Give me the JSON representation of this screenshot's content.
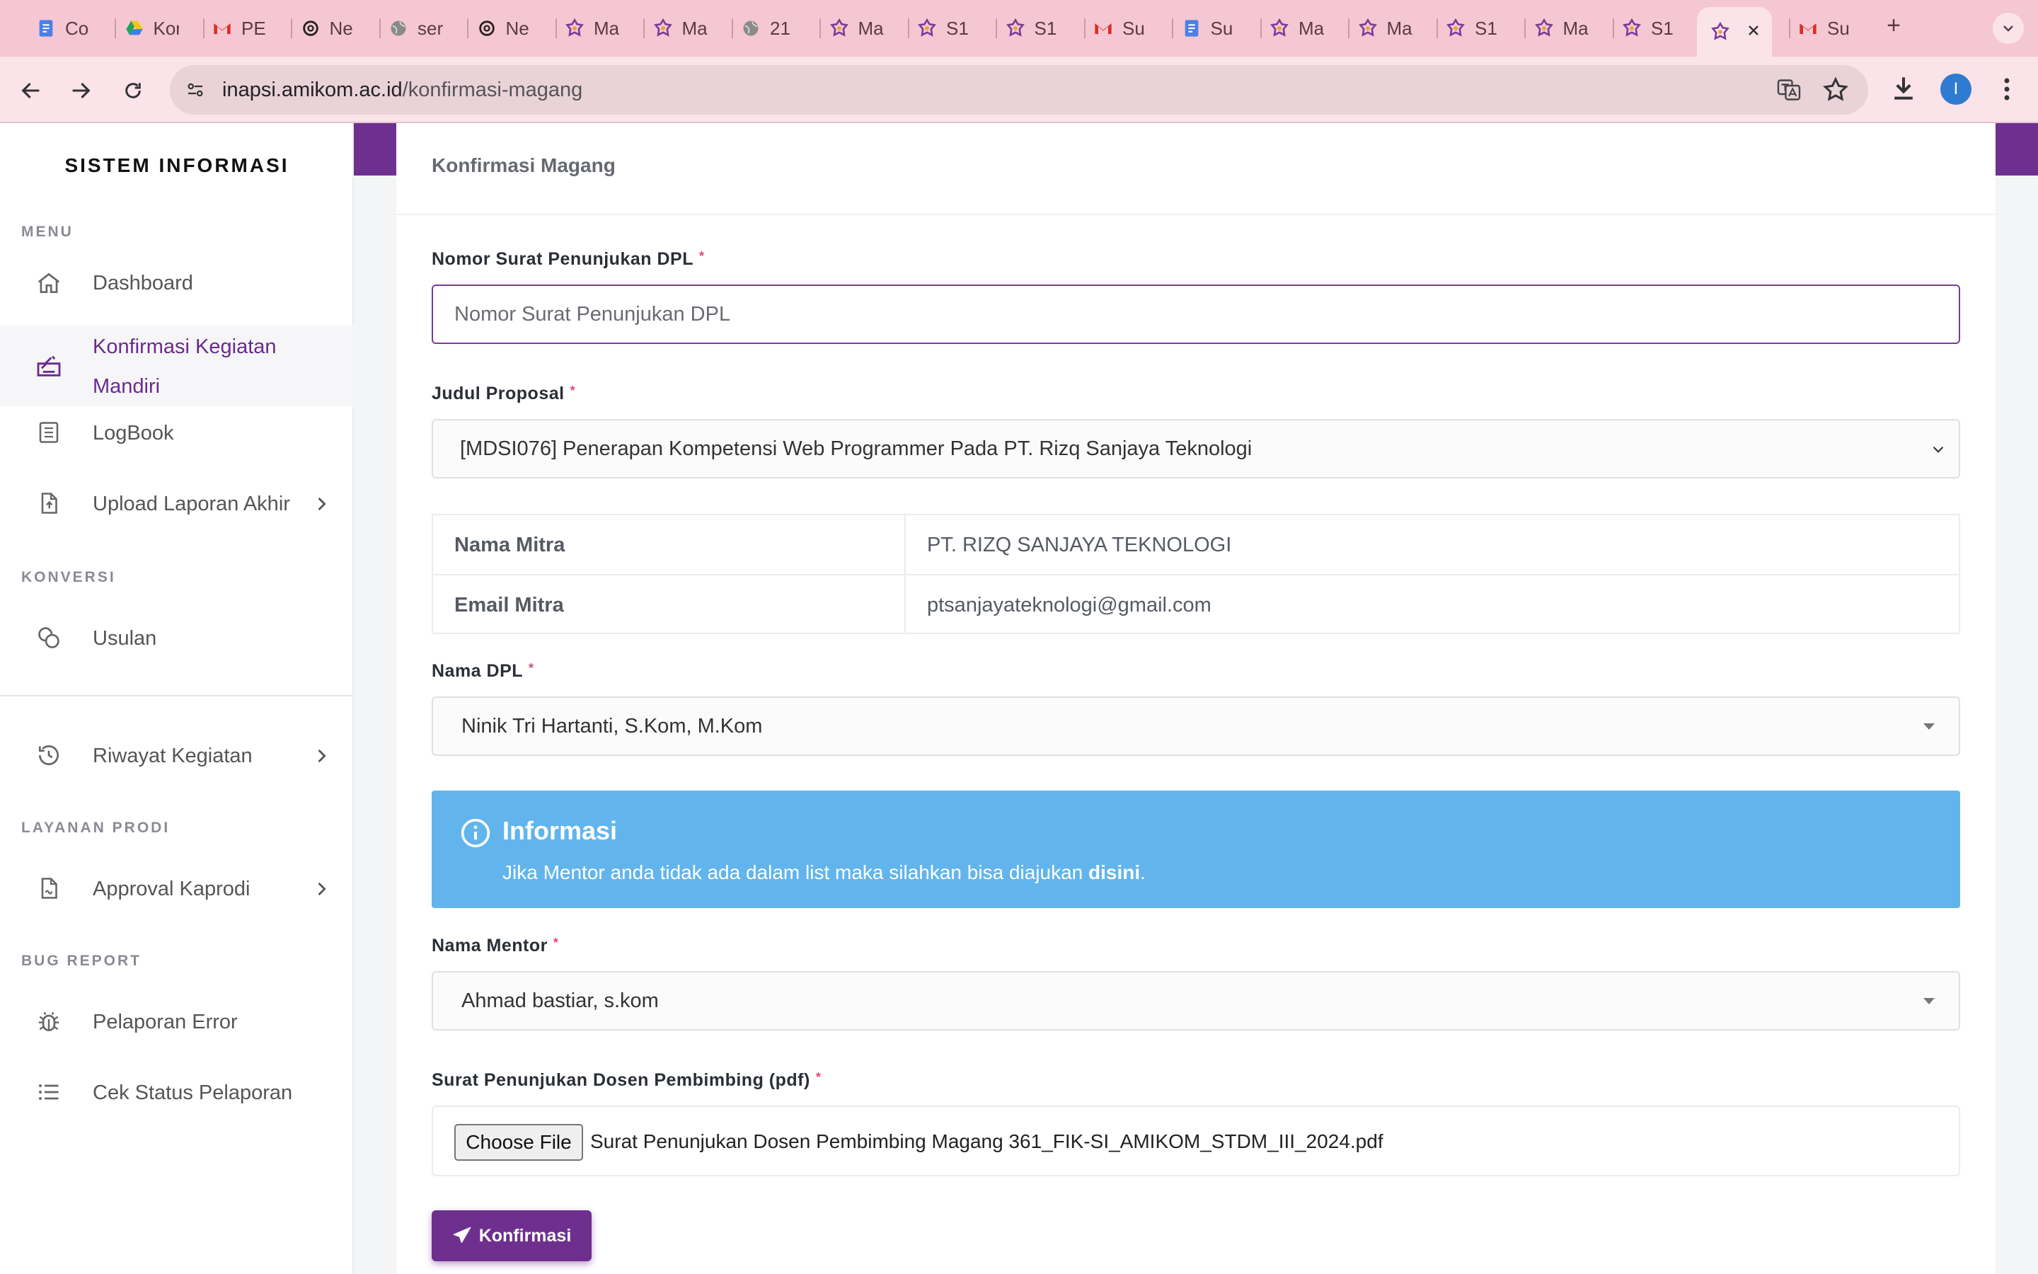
{
  "browser": {
    "tabs": [
      {
        "title": "Co",
        "icon": "google-docs-icon",
        "color": "#4a7fe5"
      },
      {
        "title": "Kor",
        "icon": "google-drive-icon",
        "color": "#1ea362"
      },
      {
        "title": "PE",
        "icon": "gmail-icon",
        "color": "#d93025"
      },
      {
        "title": "Ne",
        "icon": "chatgpt-icon",
        "color": "#222222"
      },
      {
        "title": "ser",
        "icon": "globe-icon",
        "color": "#8a8a8a"
      },
      {
        "title": "Ne",
        "icon": "chatgpt-icon",
        "color": "#222222"
      },
      {
        "title": "Ma",
        "icon": "amikom-icon",
        "color": "#7a3a9a"
      },
      {
        "title": "Ma",
        "icon": "amikom-icon",
        "color": "#7a3a9a"
      },
      {
        "title": "21",
        "icon": "globe-icon",
        "color": "#8a8a8a"
      },
      {
        "title": "Ma",
        "icon": "amikom-icon",
        "color": "#7a3a9a"
      },
      {
        "title": "S1",
        "icon": "amikom-icon",
        "color": "#7a3a9a"
      },
      {
        "title": "S1",
        "icon": "amikom-icon",
        "color": "#7a3a9a"
      },
      {
        "title": "Su",
        "icon": "gmail-icon",
        "color": "#d93025"
      },
      {
        "title": "Su",
        "icon": "google-docs-icon",
        "color": "#4a7fe5"
      },
      {
        "title": "Ma",
        "icon": "amikom-icon",
        "color": "#7a3a9a"
      },
      {
        "title": "Ma",
        "icon": "amikom-icon",
        "color": "#7a3a9a"
      },
      {
        "title": "S1",
        "icon": "amikom-icon",
        "color": "#7a3a9a"
      },
      {
        "title": "Ma",
        "icon": "amikom-icon",
        "color": "#7a3a9a"
      },
      {
        "title": "S1",
        "icon": "amikom-icon",
        "color": "#7a3a9a"
      },
      {
        "title": "",
        "icon": "amikom-icon",
        "color": "#7a3a9a",
        "active": true
      },
      {
        "title": "Su",
        "icon": "gmail-icon",
        "color": "#d93025"
      }
    ],
    "new_tab_label": "+",
    "url_host": "inapsi.amikom.ac.id",
    "url_path": "/konfirmasi-magang",
    "profile_initial": "I",
    "accent_color": "#f5c7d2"
  },
  "sidebar": {
    "brand": "SISTEM INFORMASI",
    "sections": {
      "menu": "MENU",
      "konversi": "KONVERSI",
      "layanan": "LAYANAN PRODI",
      "bug": "BUG REPORT"
    },
    "items": {
      "dashboard": "Dashboard",
      "konfirmasi_line1": "Konfirmasi Kegiatan",
      "konfirmasi_line2": "Mandiri",
      "logbook": "LogBook",
      "upload": "Upload Laporan Akhir",
      "usulan": "Usulan",
      "riwayat": "Riwayat Kegiatan",
      "approval": "Approval Kaprodi",
      "pelaporan": "Pelaporan Error",
      "cek_status": "Cek Status Pelaporan"
    },
    "active_color": "#6a2b8c"
  },
  "page": {
    "title": "Konfirmasi Magang",
    "brand_color": "#6e2f8e"
  },
  "form": {
    "nomor_surat": {
      "label": "Nomor Surat Penunjukan DPL",
      "required_mark": "*",
      "placeholder": "Nomor Surat Penunjukan DPL",
      "value": ""
    },
    "judul_proposal": {
      "label": "Judul Proposal",
      "required_mark": "*",
      "selected": "[MDSI076] Penerapan Kompetensi Web Programmer Pada PT. Rizq Sanjaya Teknologi"
    },
    "mitra": {
      "nama_key": "Nama Mitra",
      "nama_value": "PT. RIZQ SANJAYA TEKNOLOGI",
      "email_key": "Email Mitra",
      "email_value": "ptsanjayateknologi@gmail.com"
    },
    "nama_dpl": {
      "label": "Nama DPL",
      "required_mark": "*",
      "selected": "Ninik Tri Hartanti, S.Kom, M.Kom"
    },
    "info": {
      "title": "Informasi",
      "message": "Jika Mentor anda tidak ada dalam list maka silahkan bisa diajukan ",
      "link": "disini",
      "message_end": ".",
      "color": "#62b5ec"
    },
    "nama_mentor": {
      "label": "Nama Mentor",
      "required_mark": "*",
      "selected": "Ahmad bastiar, s.kom"
    },
    "surat_pdf": {
      "label": "Surat Penunjukan Dosen Pembimbing (pdf)",
      "required_mark": "*",
      "button": "Choose File",
      "file_name": "Surat Penunjukan Dosen Pembimbing Magang 361_FIK-SI_AMIKOM_STDM_III_2024.pdf"
    },
    "submit_label": "Konfirmasi"
  }
}
